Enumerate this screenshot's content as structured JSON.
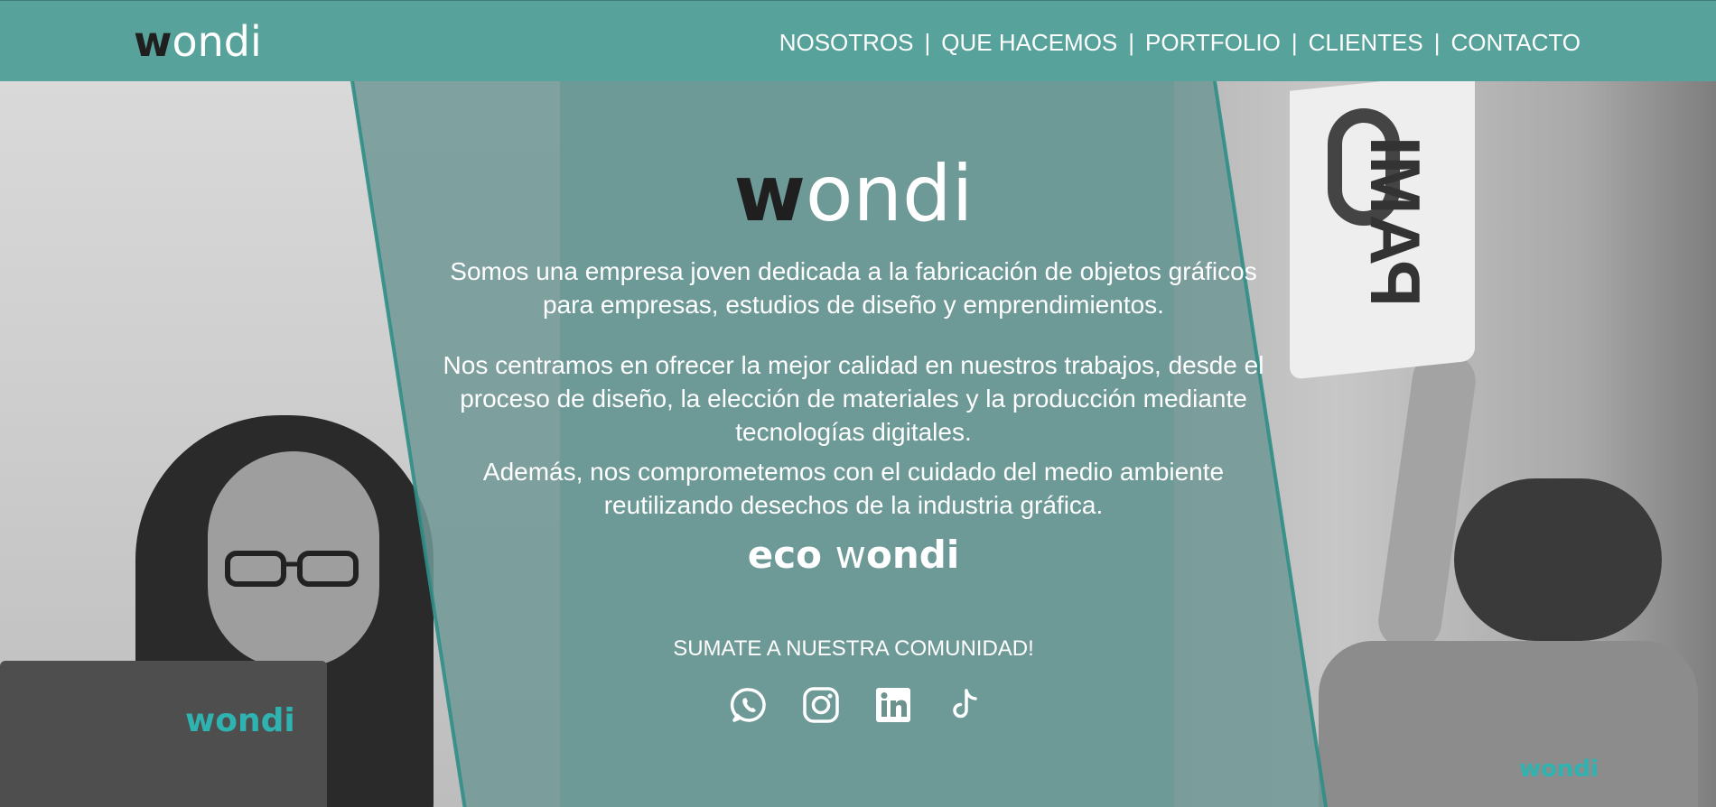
{
  "header": {
    "logo": {
      "part1": "w",
      "part2": "ondi"
    },
    "nav": [
      {
        "label": "NOSOTROS"
      },
      {
        "label": "QUE HACEMOS"
      },
      {
        "label": "PORTFOLIO"
      },
      {
        "label": "CLIENTES"
      },
      {
        "label": "CONTACTO"
      }
    ],
    "separator": "|"
  },
  "hero": {
    "logo": {
      "part1": "w",
      "part2": "ondi"
    },
    "paragraph1": "Somos una empresa joven dedicada a la fabricación de objetos gráficos para empresas, estudios de diseño y emprendimientos.",
    "paragraph2": "Nos centramos en ofrecer la mejor calidad en nuestros trabajos, desde el proceso de diseño, la elección de materiales y la producción mediante tecnologías digitales.",
    "paragraph3": "Además, nos comprometemos con el cuidado del medio ambiente reutilizando desechos de la industria gráfica.",
    "eco_logo": {
      "prefix": "eco",
      "part1": "w",
      "part2": "ondi"
    },
    "cta": "SUMATE A NUESTRA COMUNIDAD!",
    "socials": [
      {
        "icon": "whatsapp-icon"
      },
      {
        "icon": "instagram-icon"
      },
      {
        "icon": "linkedin-icon"
      },
      {
        "icon": "tiktok-icon"
      }
    ],
    "photo_marks": {
      "laptop_logo": "wondi",
      "sign_text": "PAMI",
      "shirt_logo": "wondi"
    }
  },
  "colors": {
    "header_bg": "#57a29a",
    "panel": "#70978f",
    "accent": "#2fb3b0",
    "logo_dark": "#1f1f1f"
  }
}
